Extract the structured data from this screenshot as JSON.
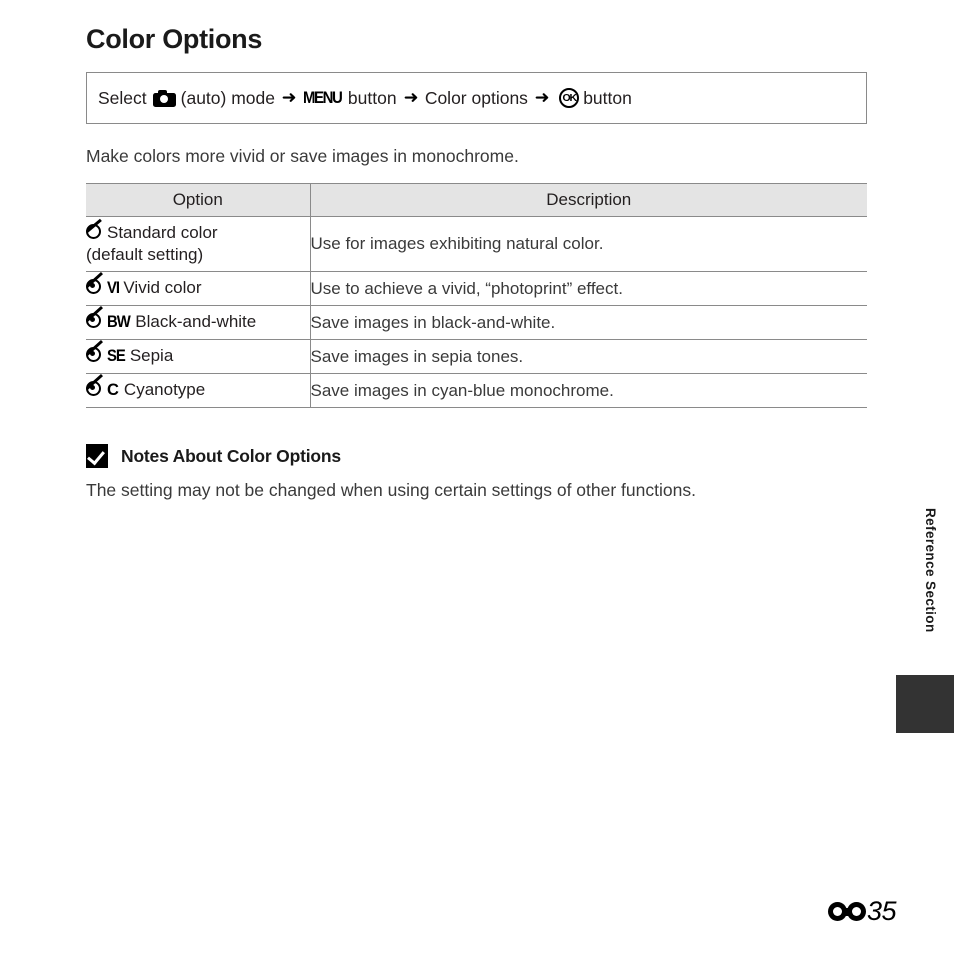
{
  "page": {
    "title": "Color Options",
    "intro": "Make colors more vivid or save images in monochrome."
  },
  "nav_path": {
    "lead": "Select",
    "camera_icon": "camera-icon",
    "mode": "(auto) mode",
    "arrow1": "➜",
    "menu_label": "MENU",
    "menu_button_text": "button",
    "arrow2": "➜",
    "menu_item": "Color options",
    "arrow3": "➜",
    "ok_icon_label": "OK",
    "ok_button_text": "button"
  },
  "table": {
    "headers": {
      "option": "Option",
      "description": "Description"
    },
    "rows": [
      {
        "icon": "standard-color-icon",
        "abbr": "",
        "name": "Standard color",
        "sub": "(default setting)",
        "description": "Use for images exhibiting natural color."
      },
      {
        "icon": "vivid-color-icon",
        "abbr": "VI",
        "name": "Vivid color",
        "sub": "",
        "description": "Use to achieve a vivid, “photoprint” effect."
      },
      {
        "icon": "black-and-white-icon",
        "abbr": "BW",
        "name": "Black-and-white",
        "sub": "",
        "description": "Save images in black-and-white."
      },
      {
        "icon": "sepia-icon",
        "abbr": "SE",
        "name": "Sepia",
        "sub": "",
        "description": "Save images in sepia tones."
      },
      {
        "icon": "cyanotype-icon",
        "abbr": "C",
        "name": "Cyanotype",
        "sub": "",
        "description": "Save images in cyan-blue monochrome."
      }
    ]
  },
  "notes": {
    "icon": "caution-check-icon",
    "heading": "Notes About Color Options",
    "body": "The setting may not be changed when using certain settings of other functions."
  },
  "side": {
    "section_label": "Reference Section",
    "tab_color": "#333333"
  },
  "footer": {
    "section_symbol": "reference-section-symbol",
    "page_number": "35"
  },
  "colors": {
    "text": "#231f20",
    "muted_text": "#3a3a3a",
    "border": "#8a8a8a",
    "header_fill": "#e4e4e4",
    "tab": "#333333"
  }
}
